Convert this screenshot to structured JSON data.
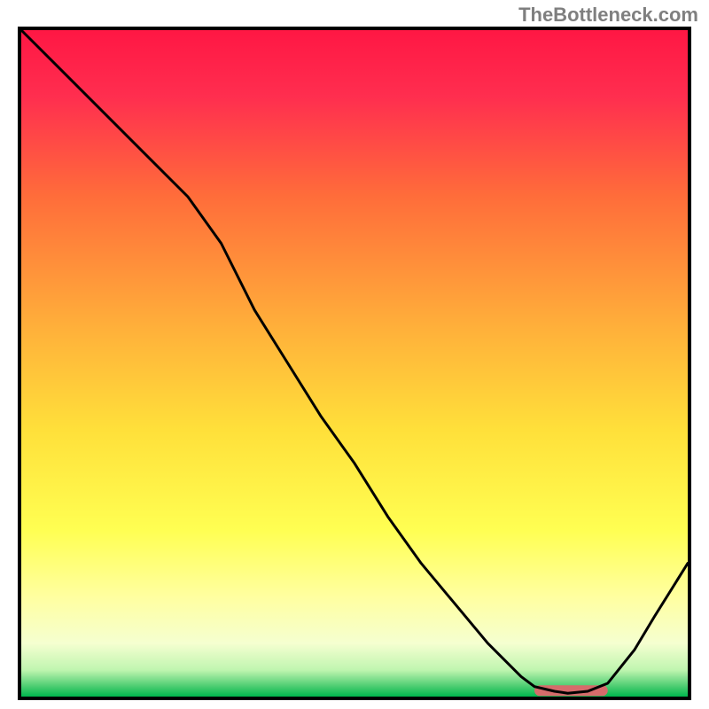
{
  "watermark": "TheBottleneck.com",
  "chart_data": {
    "type": "line",
    "title": "",
    "xlabel": "",
    "ylabel": "",
    "xlim": [
      0,
      100
    ],
    "ylim": [
      0,
      100
    ],
    "grid": false,
    "legend": false,
    "series": [
      {
        "name": "curve",
        "x": [
          0,
          5,
          10,
          15,
          20,
          25,
          30,
          35,
          40,
          45,
          50,
          55,
          60,
          65,
          70,
          75,
          77,
          80,
          82,
          85,
          88,
          92,
          95,
          100
        ],
        "y": [
          100,
          95,
          90,
          85,
          80,
          75,
          68,
          58,
          50,
          42,
          35,
          27,
          20,
          14,
          8,
          3,
          1.5,
          0.8,
          0.5,
          0.8,
          2,
          7,
          12,
          20
        ]
      }
    ],
    "highlight_bar": {
      "x_start": 77,
      "x_end": 88,
      "y": 0.9,
      "color": "#d66b6b"
    },
    "gradient_stops": [
      {
        "offset": 0.0,
        "color": "#ff1744"
      },
      {
        "offset": 0.1,
        "color": "#ff2e4f"
      },
      {
        "offset": 0.25,
        "color": "#ff6d3a"
      },
      {
        "offset": 0.45,
        "color": "#ffb13a"
      },
      {
        "offset": 0.6,
        "color": "#ffe03a"
      },
      {
        "offset": 0.75,
        "color": "#ffff52"
      },
      {
        "offset": 0.85,
        "color": "#ffffa0"
      },
      {
        "offset": 0.92,
        "color": "#f5ffd0"
      },
      {
        "offset": 0.96,
        "color": "#c0f5b0"
      },
      {
        "offset": 0.985,
        "color": "#4acc70"
      },
      {
        "offset": 1.0,
        "color": "#00b84d"
      }
    ],
    "axis_color": "#000000",
    "axis_width": 4,
    "line_color": "#000000",
    "line_width": 3
  }
}
